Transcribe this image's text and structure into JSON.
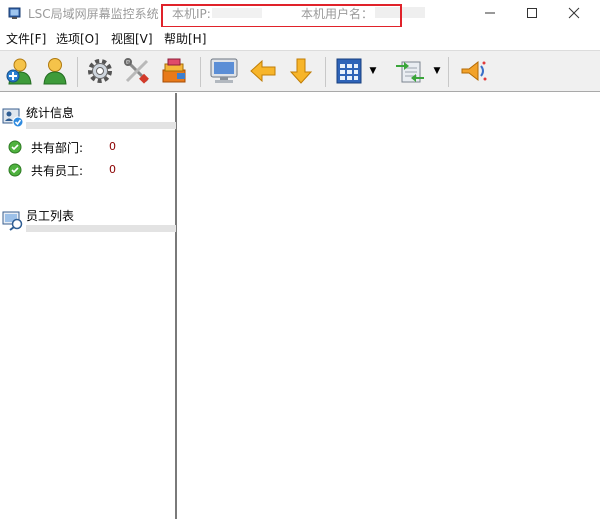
{
  "window": {
    "title": "LSC局域网屏幕监控系统",
    "ip_label": "本机IP:",
    "user_label": "本机用户名：",
    "controls": {
      "minimize": "—",
      "maximize": "☐",
      "close": "✕"
    },
    "highlight_color": "#e0222a"
  },
  "menu": [
    {
      "label": "文件[F]"
    },
    {
      "label": "选项[O]"
    },
    {
      "label": "视图[V]"
    },
    {
      "label": "帮助[H]"
    }
  ],
  "toolbar": {
    "icons": [
      "add-user-icon",
      "user-icon",
      "settings-gear-icon",
      "tools-icon",
      "database-icon",
      "monitor-icon",
      "arrow-left-icon",
      "arrow-down-icon",
      "grid-view-icon",
      "transfer-icon",
      "broadcast-icon"
    ],
    "dropdown_glyph": "▼"
  },
  "sidebar": {
    "stats_section": {
      "title": "统计信息",
      "icon": "stats-user-icon",
      "items": [
        {
          "label": "共有部门:",
          "value": "0"
        },
        {
          "label": "共有员工:",
          "value": "0"
        }
      ]
    },
    "employee_section": {
      "title": "员工列表",
      "icon": "search-monitor-icon"
    }
  }
}
